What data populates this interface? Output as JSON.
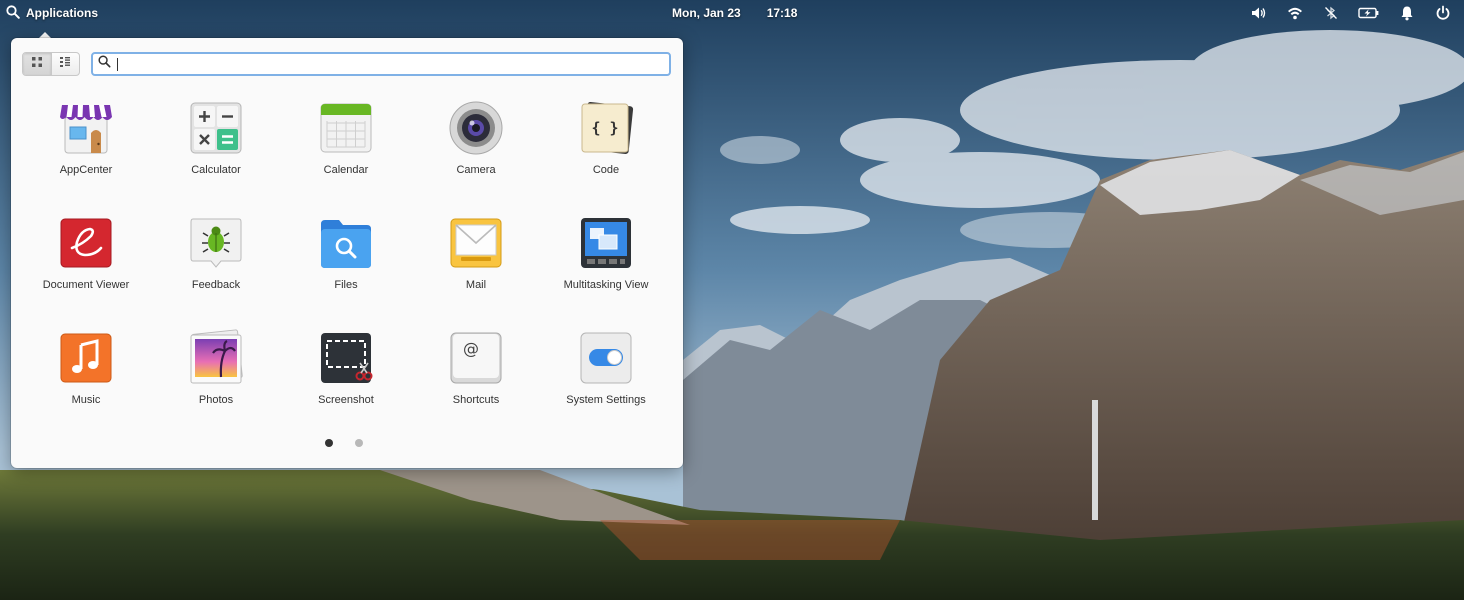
{
  "panel": {
    "applications_label": "Applications",
    "date": "Mon, Jan 23",
    "time": "17:18",
    "indicators": [
      "volume-icon",
      "wifi-icon",
      "bluetooth-off-icon",
      "battery-charging-icon",
      "notifications-icon",
      "power-icon"
    ]
  },
  "menu": {
    "view_modes": [
      "grid-view-icon",
      "category-view-icon"
    ],
    "active_view": "grid",
    "search": {
      "value": "",
      "placeholder": ""
    },
    "apps": [
      {
        "label": "AppCenter",
        "icon": "appcenter-icon"
      },
      {
        "label": "Calculator",
        "icon": "calculator-icon"
      },
      {
        "label": "Calendar",
        "icon": "calendar-icon"
      },
      {
        "label": "Camera",
        "icon": "camera-icon"
      },
      {
        "label": "Code",
        "icon": "code-icon"
      },
      {
        "label": "Document Viewer",
        "icon": "document-viewer-icon"
      },
      {
        "label": "Feedback",
        "icon": "feedback-icon"
      },
      {
        "label": "Files",
        "icon": "files-icon"
      },
      {
        "label": "Mail",
        "icon": "mail-icon"
      },
      {
        "label": "Multitasking View",
        "icon": "multitasking-view-icon"
      },
      {
        "label": "Music",
        "icon": "music-icon"
      },
      {
        "label": "Photos",
        "icon": "photos-icon"
      },
      {
        "label": "Screenshot",
        "icon": "screenshot-icon"
      },
      {
        "label": "Shortcuts",
        "icon": "shortcuts-icon"
      },
      {
        "label": "System Settings",
        "icon": "system-settings-icon"
      }
    ],
    "pages": 2,
    "current_page": 1
  },
  "colors": {
    "accent": "#7fb1e6",
    "dot_active": "#333333",
    "dot_inactive": "#b8b8b8"
  }
}
